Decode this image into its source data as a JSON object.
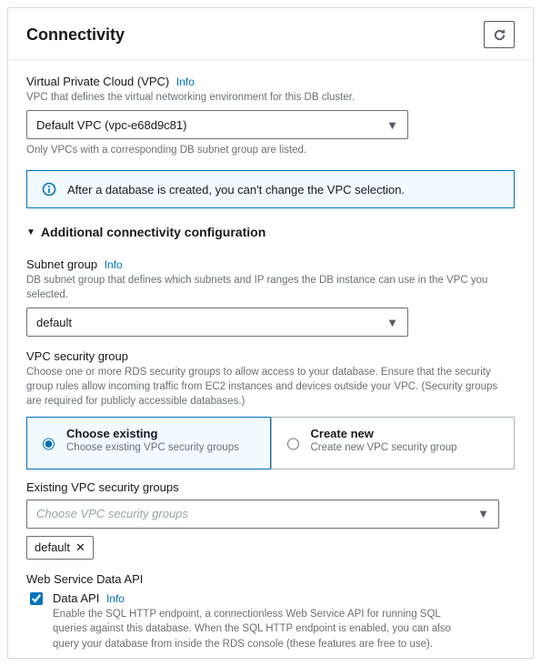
{
  "panel": {
    "title": "Connectivity"
  },
  "vpc": {
    "label": "Virtual Private Cloud (VPC)",
    "info": "Info",
    "desc": "VPC that defines the virtual networking environment for this DB cluster.",
    "value": "Default VPC (vpc-e68d9c81)",
    "helper": "Only VPCs with a corresponding DB subnet group are listed."
  },
  "alert": {
    "text": "After a database is created, you can't change the VPC selection."
  },
  "expander": {
    "label": "Additional connectivity configuration"
  },
  "subnet": {
    "label": "Subnet group",
    "info": "Info",
    "desc": "DB subnet group that defines which subnets and IP ranges the DB instance can use in the VPC you selected.",
    "value": "default"
  },
  "sg": {
    "label": "VPC security group",
    "desc": "Choose one or more RDS security groups to allow access to your database. Ensure that the security group rules allow incoming traffic from EC2 instances and devices outside your VPC. (Security groups are required for publicly accessible databases.)",
    "options": [
      {
        "title": "Choose existing",
        "desc": "Choose existing VPC security groups"
      },
      {
        "title": "Create new",
        "desc": "Create new VPC security group"
      }
    ],
    "existing_label": "Existing VPC security groups",
    "existing_placeholder": "Choose VPC security groups",
    "token": "default"
  },
  "dataapi": {
    "section": "Web Service Data API",
    "label": "Data API",
    "info": "Info",
    "desc": "Enable the SQL HTTP endpoint, a connectionless Web Service API for running SQL queries against this database. When the SQL HTTP endpoint is enabled, you can also query your database from inside the RDS console (these features are free to use)."
  }
}
